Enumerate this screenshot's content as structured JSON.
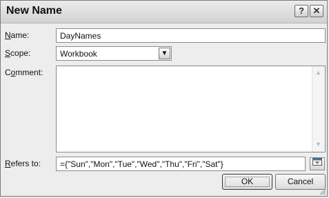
{
  "window": {
    "title": "New Name",
    "help_label": "?",
    "close_label": "✕"
  },
  "name": {
    "label_prefix": "",
    "label_accel": "N",
    "label_rest": "ame:",
    "value": "DayNames"
  },
  "scope": {
    "label_accel": "S",
    "label_rest": "cope:",
    "value": "Workbook",
    "arrow": "▼"
  },
  "comment": {
    "label_pre": "C",
    "label_accel": "o",
    "label_rest": "mment:",
    "value": "",
    "scroll_up": "▲",
    "scroll_down": "▼"
  },
  "refers_to": {
    "label_accel": "R",
    "label_rest": "efers to:",
    "value": "={\"Sun\",\"Mon\",\"Tue\",\"Wed\",\"Thu\",\"Fri\",\"Sat\"}"
  },
  "buttons": {
    "ok": "OK",
    "cancel": "Cancel"
  },
  "icons": {
    "collapse": "collapse-dialog-icon",
    "resize": "resize-grip-icon"
  }
}
